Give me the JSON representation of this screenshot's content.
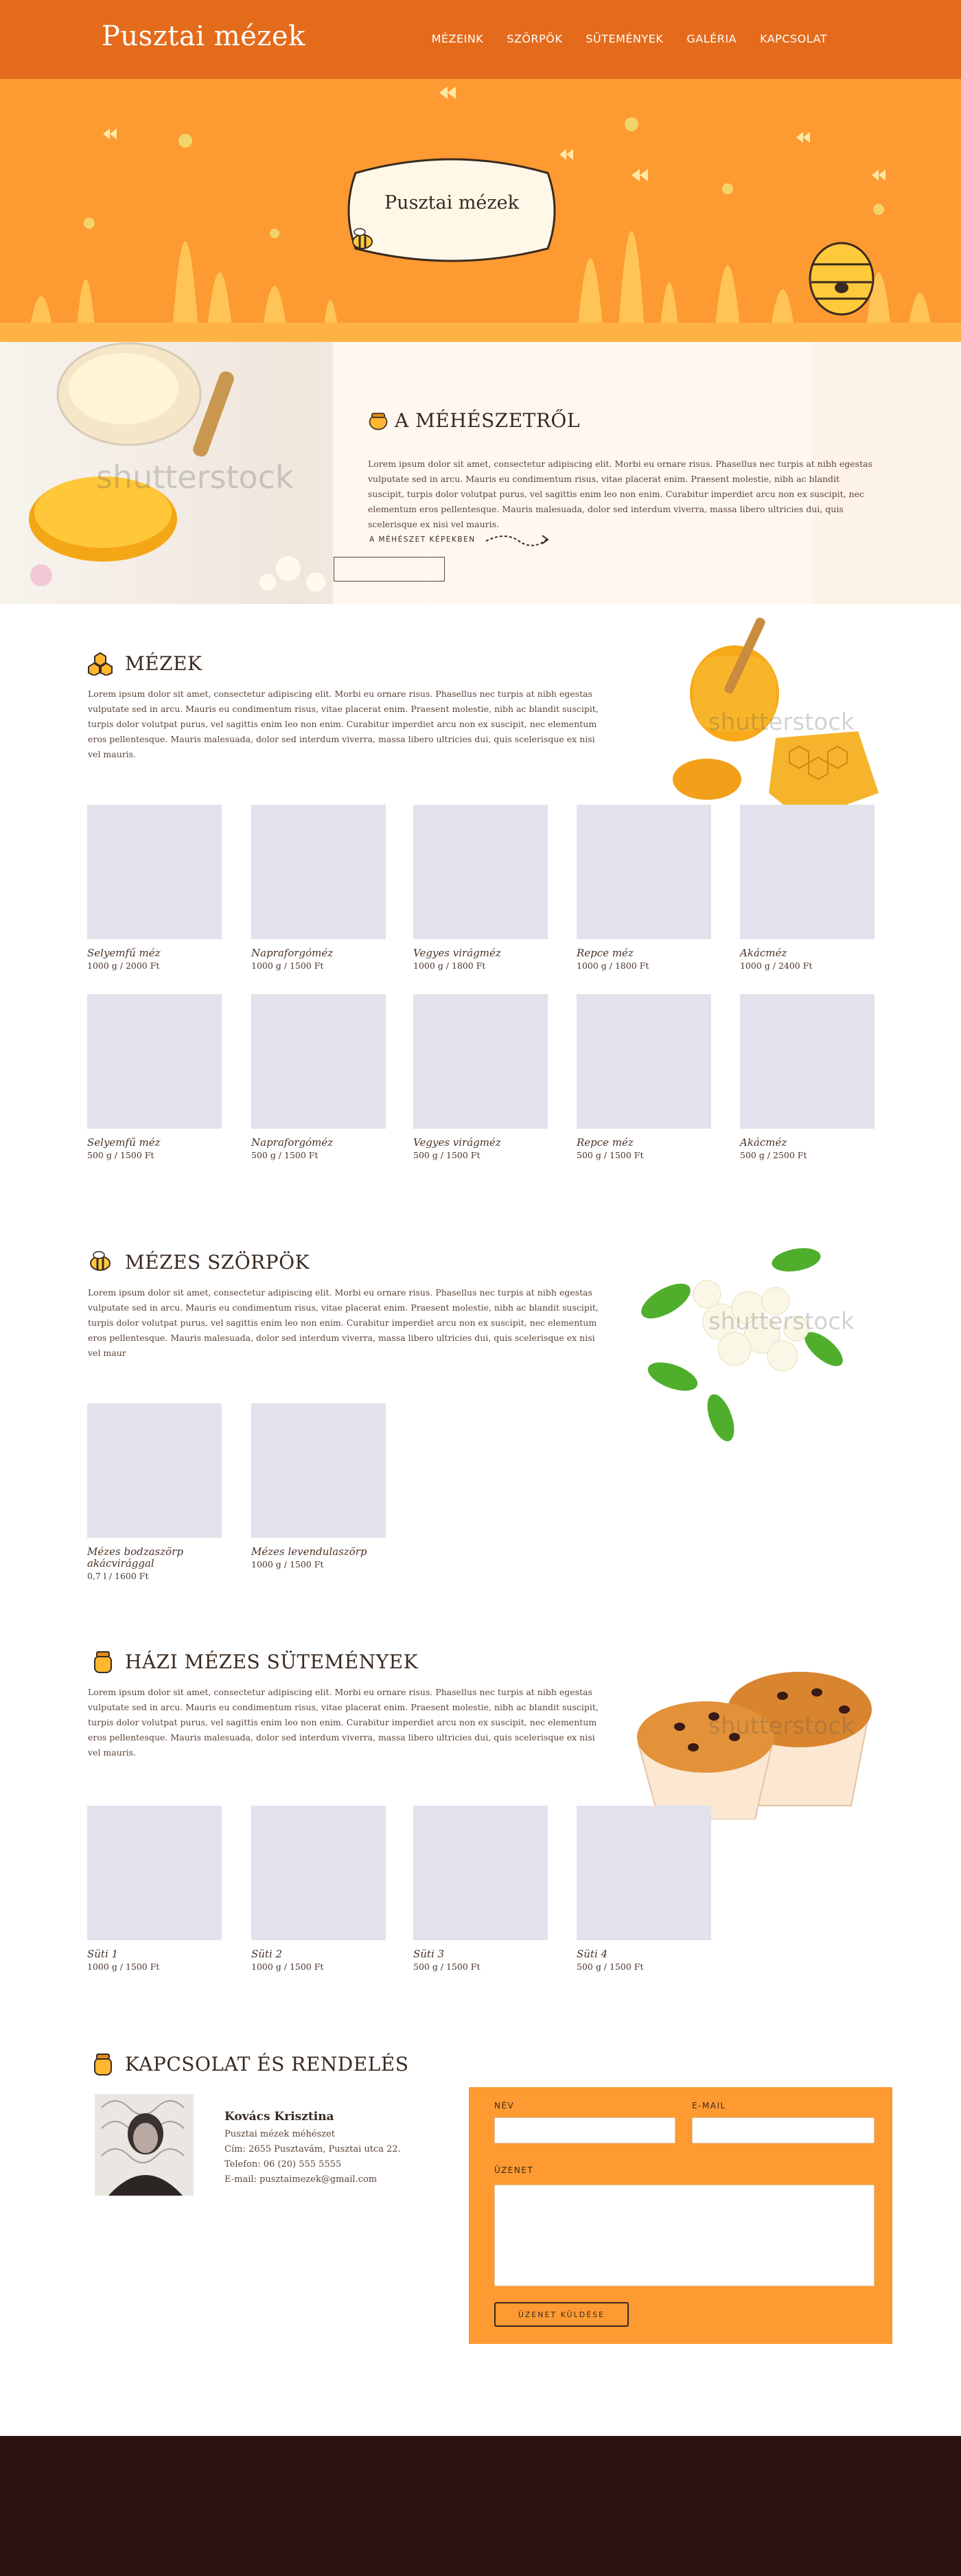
{
  "site": {
    "logo": "Pusztai mézek"
  },
  "nav": {
    "items": [
      "MÉZEINK",
      "SZÖRPÖK",
      "SÜTEMÉNYEK",
      "GALÉRIA",
      "KAPCSOLAT"
    ]
  },
  "hero": {
    "badge": "Pusztai mézek"
  },
  "about": {
    "title": "A MÉHÉSZETRŐL",
    "text": "Lorem ipsum dolor sit amet, consectetur adipiscing elit. Morbi eu ornare risus. Phasellus nec turpis at nibh egestas vulputate sed in arcu. Mauris eu condimentum risus, vitae placerat enim. Praesent molestie, nibh ac blandit suscipit, turpis dolor volutpat purus, vel sagittis enim leo non enim. Curabitur imperdiet arcu non ex suscipit, nec elementum eros pellentesque. Mauris malesuada, dolor sed interdum viverra, massa libero ultricies dui, quis scelerisque ex nisi vel mauris.",
    "link": "A MÉHÉSZET KÉPEKBEN",
    "watermark": "shutterstock"
  },
  "honey": {
    "title": "MÉZEK",
    "text": "Lorem ipsum dolor sit amet, consectetur adipiscing elit. Morbi eu ornare risus. Phasellus nec turpis at nibh egestas vulputate sed in arcu. Mauris eu condimentum risus, vitae placerat enim. Praesent molestie, nibh ac blandit suscipit, turpis dolor volutpat purus, vel sagittis enim leo non enim. Curabitur imperdiet arcu non ex suscipit, nec elementum eros pellentesque. Mauris malesuada, dolor sed interdum viverra, massa libero ultricies dui, quis scelerisque ex nisi vel mauris.",
    "watermark": "shutterstock",
    "products": [
      {
        "name": "Selyemfű méz",
        "price": "1000 g  / 2000 Ft"
      },
      {
        "name": "Napraforgóméz",
        "price": "1000 g  / 1500 Ft"
      },
      {
        "name": "Vegyes virágméz",
        "price": "1000 g  / 1800 Ft"
      },
      {
        "name": "Repce méz",
        "price": "1000 g  / 1800 Ft"
      },
      {
        "name": "Akácméz",
        "price": "1000 g  / 2400 Ft"
      },
      {
        "name": "Selyemfű méz",
        "price": "500 g  / 1500 Ft"
      },
      {
        "name": "Napraforgóméz",
        "price": "500 g  / 1500 Ft"
      },
      {
        "name": "Vegyes virágméz",
        "price": "500 g  / 1500 Ft"
      },
      {
        "name": "Repce méz",
        "price": "500 g  / 1500 Ft"
      },
      {
        "name": "Akácméz",
        "price": "500 g  / 2500 Ft"
      }
    ]
  },
  "syrups": {
    "title": "MÉZES SZÖRPÖK",
    "text": "Lorem ipsum dolor sit amet, consectetur adipiscing elit. Morbi eu ornare risus. Phasellus nec turpis at nibh egestas vulputate sed in arcu. Mauris eu condimentum risus, vitae placerat enim. Praesent molestie, nibh ac blandit suscipit, turpis dolor volutpat purus, vel sagittis enim leo non enim. Curabitur imperdiet arcu non ex suscipit, nec elementum eros pellentesque. Mauris malesuada, dolor sed interdum viverra, massa libero ultricies dui, quis scelerisque ex nisi vel maur",
    "watermark": "shutterstock",
    "products": [
      {
        "name": "Mézes bodzaszörp akácvirággal",
        "price": "0,7 l  / 1600 Ft"
      },
      {
        "name": "Mézes levendulaszörp",
        "price": "1000 g  / 1500 Ft"
      }
    ]
  },
  "cakes": {
    "title": "HÁZI MÉZES SÜTEMÉNYEK",
    "text": "Lorem ipsum dolor sit amet, consectetur adipiscing elit. Morbi eu ornare risus. Phasellus nec turpis at nibh egestas vulputate sed in arcu. Mauris eu condimentum risus, vitae placerat enim. Praesent molestie, nibh ac blandit suscipit, turpis dolor volutpat purus, vel sagittis enim leo non enim. Curabitur imperdiet arcu non ex suscipit, nec elementum eros pellentesque. Mauris malesuada, dolor sed interdum viverra, massa libero ultricies dui, quis scelerisque ex nisi vel mauris.",
    "watermark": "shutterstock",
    "products": [
      {
        "name": "Süti 1",
        "price": "1000 g  / 1500 Ft"
      },
      {
        "name": "Süti 2",
        "price": "1000 g  / 1500 Ft"
      },
      {
        "name": "Süti 3",
        "price": "500 g  / 1500 Ft"
      },
      {
        "name": "Süti 4",
        "price": "500 g  / 1500 Ft"
      }
    ]
  },
  "contact": {
    "title": "KAPCSOLAT ÉS RENDELÉS",
    "name": "Kovács Krisztina",
    "lines": [
      "Pusztai mézek méhészet",
      "Cím: 2655 Pusztavám, Pusztai utca 22.",
      "Telefon: 06 (20) 555 5555",
      "E-mail: pusztaimezek@gmail.com"
    ],
    "form": {
      "name_label": "NÉV",
      "email_label": "E-MAIL",
      "message_label": "ÜZENET",
      "submit_label": "ÜZENET KÜLDÉSE"
    }
  },
  "colors": {
    "header": "#e46b1c",
    "accent": "#fe9a32",
    "footer": "#2c1212",
    "placeholder": "#e3e1eb"
  }
}
